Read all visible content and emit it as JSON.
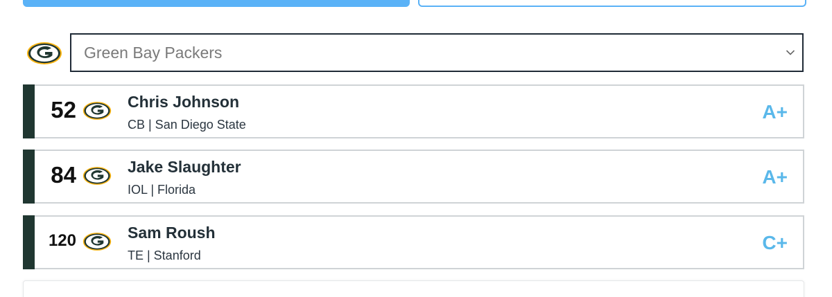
{
  "team_selector": {
    "selected_team": "Green Bay Packers",
    "logo_icon": "packers-g-logo-icon",
    "chevron_icon": "chevron-down-icon"
  },
  "colors": {
    "accent_blue": "#5AB2F7",
    "grade_blue": "#5AB8EA",
    "team_green": "#203731",
    "team_gold": "#FFB612"
  },
  "picks": [
    {
      "number": "52",
      "name": "Chris Johnson",
      "meta": "CB | San Diego State",
      "grade": "A+"
    },
    {
      "number": "84",
      "name": "Jake Slaughter",
      "meta": "IOL | Florida",
      "grade": "A+"
    },
    {
      "number": "120",
      "name": "Sam Roush",
      "meta": "TE | Stanford",
      "grade": "C+"
    }
  ]
}
